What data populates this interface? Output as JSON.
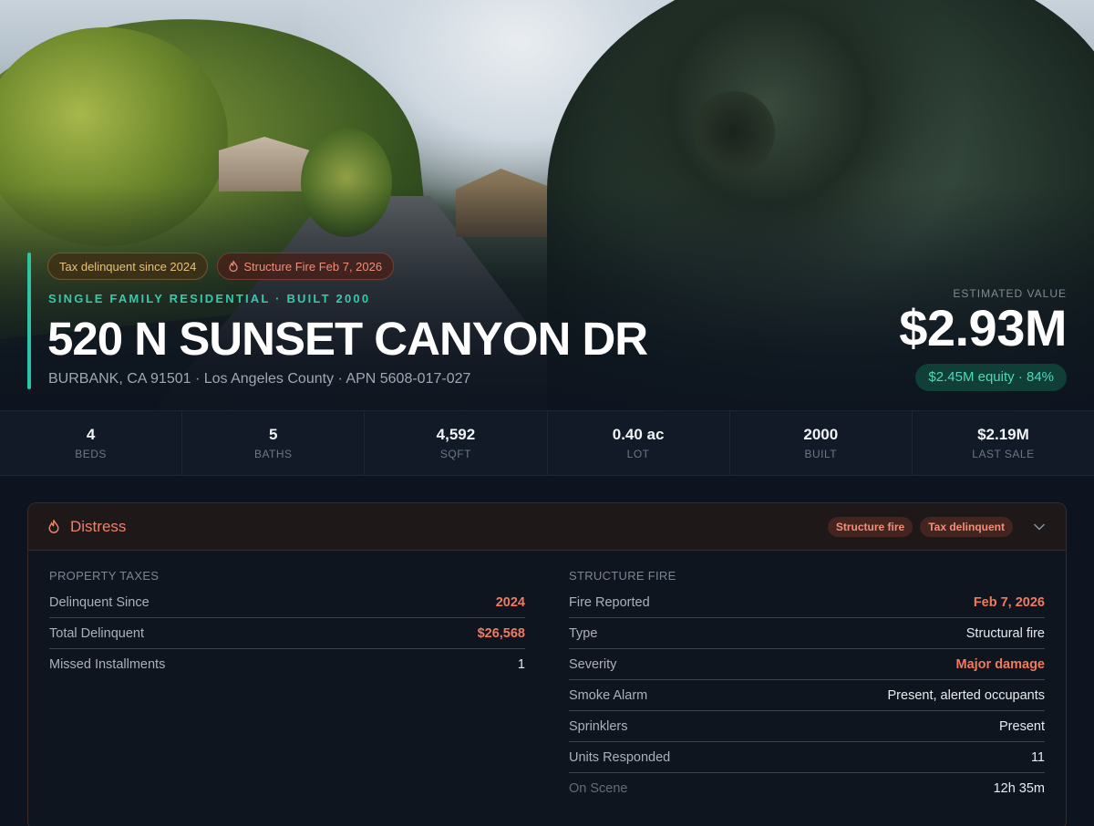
{
  "hero": {
    "badges": {
      "tax": "Tax delinquent since 2024",
      "fire": "Structure Fire Feb 7, 2026"
    },
    "subtitle": "SINGLE FAMILY RESIDENTIAL · BUILT 2000",
    "title": "520 N SUNSET CANYON DR",
    "address_line": "BURBANK, CA 91501 · Los Angeles County · APN 5608-017-027",
    "value_label": "ESTIMATED VALUE",
    "value_amount": "$2.93M",
    "equity": "$2.45M equity · 84%"
  },
  "stats": [
    {
      "value": "4",
      "label": "BEDS"
    },
    {
      "value": "5",
      "label": "BATHS"
    },
    {
      "value": "4,592",
      "label": "SQFT"
    },
    {
      "value": "0.40 ac",
      "label": "LOT"
    },
    {
      "value": "2000",
      "label": "BUILT"
    },
    {
      "value": "$2.19M",
      "label": "LAST SALE"
    }
  ],
  "distress": {
    "title": "Distress",
    "tags": [
      "Structure fire",
      "Tax delinquent"
    ],
    "property_taxes": {
      "label": "PROPERTY TAXES",
      "rows": [
        {
          "key": "Delinquent Since",
          "value": "2024"
        },
        {
          "key": "Total Delinquent",
          "value": "$26,568"
        },
        {
          "key": "Missed Installments",
          "value": "1"
        }
      ]
    },
    "structure_fire": {
      "label": "STRUCTURE FIRE",
      "rows": [
        {
          "key": "Fire Reported",
          "value": "Feb 7, 2026"
        },
        {
          "key": "Type",
          "value": "Structural fire"
        },
        {
          "key": "Severity",
          "value": "Major damage"
        },
        {
          "key": "Smoke Alarm",
          "value": "Present, alerted occupants"
        },
        {
          "key": "Sprinklers",
          "value": "Present"
        },
        {
          "key": "Units Responded",
          "value": "11"
        },
        {
          "key": "On Scene",
          "value": "12h 35m"
        }
      ]
    }
  },
  "colors": {
    "accent": "#2ec4a8",
    "danger": "#f07a5e",
    "warning": "#e5c27a",
    "background": "#0d141f"
  },
  "icons": {
    "fire_badge": "flame-icon",
    "panel": "flame-icon",
    "collapse": "chevron-down-icon"
  }
}
